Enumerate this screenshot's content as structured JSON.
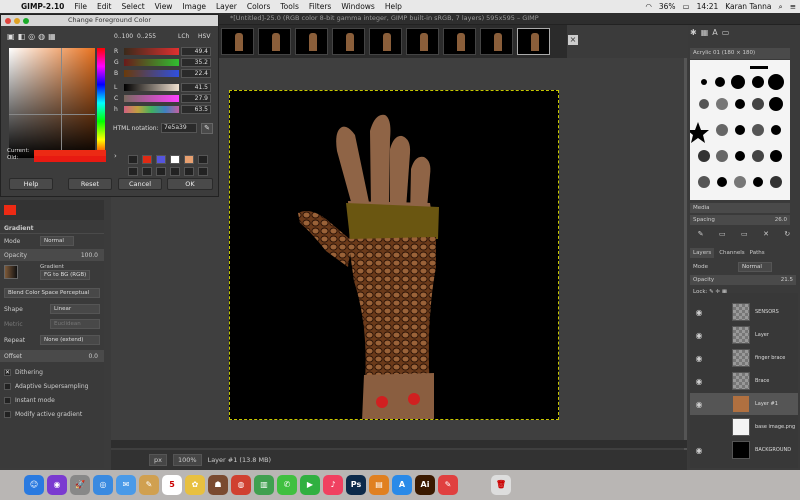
{
  "menubar": {
    "apple": "",
    "app": "GIMP-2.10",
    "items": [
      "File",
      "Edit",
      "Select",
      "View",
      "Image",
      "Layer",
      "Colors",
      "Tools",
      "Filters",
      "Windows",
      "Help"
    ],
    "battery": "36%",
    "time": "14:21",
    "user": "Karan Tanna"
  },
  "window": {
    "title": "*[Untitled]-25.0 (RGB color 8-bit gamma integer, GIMP built-in sRGB, 7 layers) 595x595 – GIMP"
  },
  "color_dialog": {
    "title": "Change Foreground Color",
    "range_100": "0..100",
    "range_255": "0..255",
    "lch": "LCh",
    "hsv": "HSV",
    "sliders": [
      {
        "label": "R",
        "value": "49.4",
        "color": "#e03030"
      },
      {
        "label": "G",
        "value": "35.2",
        "color": "#30c030"
      },
      {
        "label": "B",
        "value": "22.4",
        "color": "#3050e0"
      },
      {
        "label": "L",
        "value": "41.5",
        "color": "#e0e0e0"
      },
      {
        "label": "C",
        "value": "27.9",
        "color": "#ff40ff"
      },
      {
        "label": "h",
        "value": "63.5",
        "color": "#f08030"
      }
    ],
    "html_label": "HTML notation:",
    "html_value": "7e5a39",
    "current_label": "Current:",
    "old_label": "Old:",
    "current_color": "#ec2a14",
    "old_color": "#e81a12",
    "history_colors": [
      "#222222",
      "#e02a14",
      "#5555dd",
      "#ffffff",
      "#e8a070",
      "#222222",
      "#222222",
      "#222222",
      "#222222",
      "#222222",
      "#222222",
      "#222222"
    ],
    "buttons": {
      "help": "Help",
      "reset": "Reset",
      "cancel": "Cancel",
      "ok": "OK"
    }
  },
  "tool_options": {
    "title": "Gradient",
    "mode_label": "Mode",
    "mode_value": "Normal",
    "opacity_label": "Opacity",
    "opacity_value": "100.0",
    "gradient_label": "Gradient",
    "gradient_value": "FG to BG (RGB)",
    "blend_space": "Blend Color Space Perceptual",
    "shape_label": "Shape",
    "shape_value": "Linear",
    "metric_label": "Metric",
    "metric_value": "Euclidean",
    "repeat_label": "Repeat",
    "repeat_value": "None (extend)",
    "offset_label": "Offset",
    "offset_value": "0.0",
    "dithering": "Dithering",
    "adaptive": "Adaptive Supersampling",
    "instant": "Instant mode",
    "modify": "Modify active gradient"
  },
  "brushes": {
    "header": "Acrylic 01 (180 × 180)",
    "filter_label": "Media",
    "spacing_label": "Spacing",
    "spacing_value": "26.0"
  },
  "layers_panel": {
    "tabs": [
      "Layers",
      "Channels",
      "Paths"
    ],
    "mode_label": "Mode",
    "mode_value": "Normal",
    "opacity_label": "Opacity",
    "opacity_value": "21.5",
    "lock_label": "Lock:",
    "layers": [
      {
        "name": "SENSORS"
      },
      {
        "name": "Layer"
      },
      {
        "name": "finger brace"
      },
      {
        "name": "Brace"
      },
      {
        "name": "Layer #1"
      },
      {
        "name": "base image.png"
      },
      {
        "name": "BACKGROUND"
      }
    ]
  },
  "statusbar": {
    "unit": "px",
    "zoom": "100%",
    "info": "Layer #1 (13.8 MB)"
  },
  "dock_icons": [
    {
      "name": "finder",
      "color": "#2a7ae0",
      "glyph": "☺"
    },
    {
      "name": "siri",
      "color": "#7a3ad0",
      "glyph": "◉"
    },
    {
      "name": "launchpad",
      "color": "#888",
      "glyph": "🚀"
    },
    {
      "name": "safari",
      "color": "#3a8ae0",
      "glyph": "◎"
    },
    {
      "name": "mail",
      "color": "#4a9ae8",
      "glyph": "✉"
    },
    {
      "name": "notes",
      "color": "#d0a050",
      "glyph": "✎"
    },
    {
      "name": "calendar",
      "color": "#fff",
      "glyph": "5"
    },
    {
      "name": "photos",
      "color": "#e8c040",
      "glyph": "✿"
    },
    {
      "name": "gimp",
      "color": "#7a4a30",
      "glyph": "☗"
    },
    {
      "name": "chrome",
      "color": "#d04030",
      "glyph": "◍"
    },
    {
      "name": "numbers",
      "color": "#40a050",
      "glyph": "▥"
    },
    {
      "name": "messages",
      "color": "#40c040",
      "glyph": "✆"
    },
    {
      "name": "facetime",
      "color": "#30b040",
      "glyph": "▶"
    },
    {
      "name": "music",
      "color": "#f04060",
      "glyph": "♪"
    },
    {
      "name": "photoshop",
      "color": "#0c2a4a",
      "glyph": "Ps"
    },
    {
      "name": "books",
      "color": "#e08020",
      "glyph": "▤"
    },
    {
      "name": "app-store",
      "color": "#2a8ae8",
      "glyph": "A"
    },
    {
      "name": "illustrator",
      "color": "#3a1a00",
      "glyph": "Ai"
    },
    {
      "name": "paint",
      "color": "#e04040",
      "glyph": "✎"
    },
    {
      "name": "trash",
      "color": "#ddd",
      "glyph": "🗑"
    }
  ]
}
